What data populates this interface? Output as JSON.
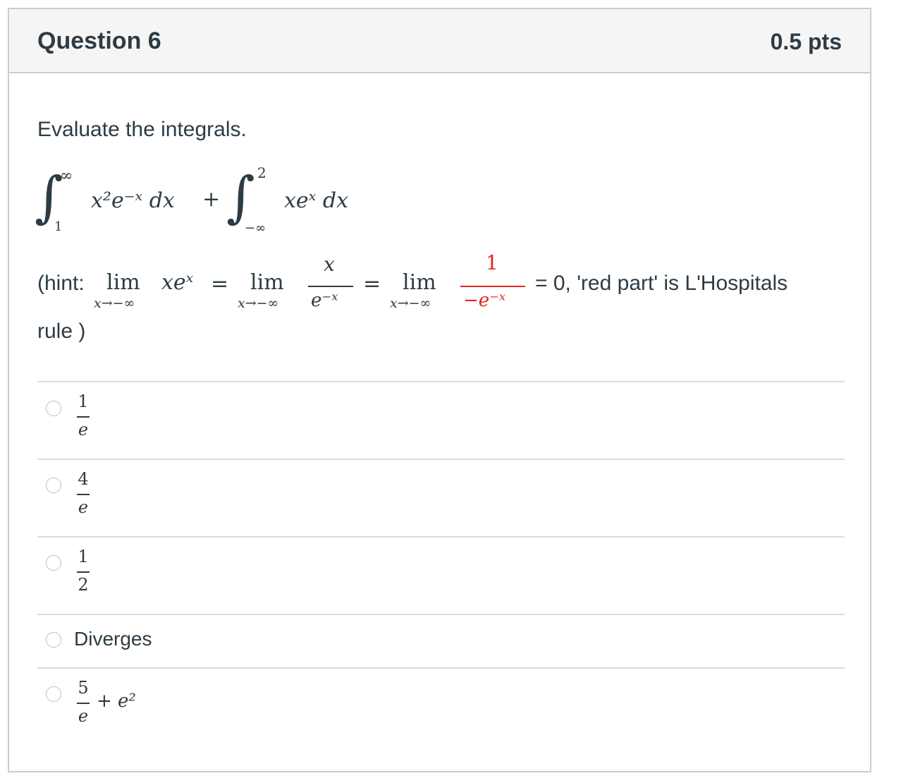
{
  "question": {
    "title": "Question 6",
    "points": "0.5 pts",
    "prompt": "Evaluate the integrals."
  },
  "integral_expression": {
    "first": {
      "upper": "∞",
      "lower": "1",
      "integrand": "x²e⁻ˣ dx"
    },
    "plus": "+",
    "second": {
      "upper": "2",
      "lower": "−∞",
      "integrand": "xeˣ dx"
    }
  },
  "hint": {
    "open": "(hint:",
    "lim": "lim",
    "lim_sub": "x→−∞",
    "term1": "xeˣ",
    "eq": "=",
    "frac1_num": "x",
    "frac1_den": "e⁻ˣ",
    "frac2_num": "1",
    "frac2_den": "−e⁻ˣ",
    "tail": "= 0, 'red part' is L'Hospitals",
    "rule": "rule )",
    "highlight_color": "#e4261c"
  },
  "answers": [
    {
      "numerator": "1",
      "denominator": "e"
    },
    {
      "numerator": "4",
      "denominator": "e"
    },
    {
      "numerator": "1",
      "denominator": "2"
    },
    {
      "text": "Diverges"
    },
    {
      "numerator": "5",
      "denominator": "e",
      "suffix": "+ e²"
    }
  ]
}
